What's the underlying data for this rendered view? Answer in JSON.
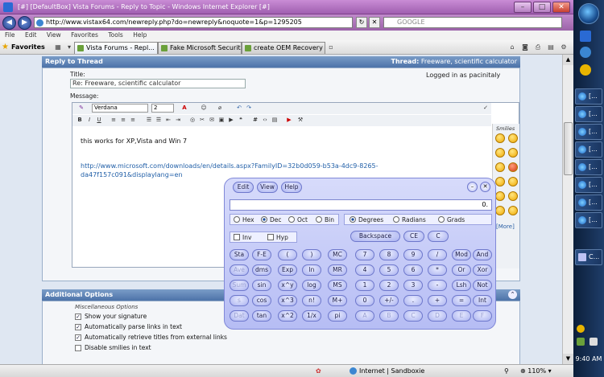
{
  "window": {
    "title": "[#] [DefaultBox] Vista Forums - Reply to Topic - Windows Internet Explorer [#]",
    "min": "–",
    "max": "□",
    "close": "✕"
  },
  "address": {
    "url": "http://www.vistax64.com/newreply.php?do=newreply&noquote=1&p=1295205",
    "search_placeholder": "GOOGLE"
  },
  "menu": [
    "File",
    "Edit",
    "View",
    "Favorites",
    "Tools",
    "Help"
  ],
  "favorites": {
    "label": "Favorites"
  },
  "tabs": [
    {
      "label": "Vista Forums - Repl..."
    },
    {
      "label": "Fake Microsoft Securit..."
    },
    {
      "label": "create OEM Recovery ..."
    }
  ],
  "reply": {
    "header": "Reply to Thread",
    "thread_label": "Thread:",
    "thread_title": "Freeware, scientific calculator",
    "logged_in_prefix": "Logged in as",
    "user": "pacinitaly",
    "title_label": "Title:",
    "title_value": "Re: Freeware, scientific calculator",
    "message_label": "Message:",
    "font": "Verdana",
    "size": "2",
    "message_line": "this works for XP,Vista and Win 7",
    "message_link": "http://www.microsoft.com/downloads/en/details.aspx?FamilyID=32b0d059-b53a-4dc9-8265-da47f157c091&displaylang=en",
    "smilies_title": "Smilies",
    "more": "[More]"
  },
  "options": {
    "header": "Additional Options",
    "misc_title": "Miscellaneous Options",
    "items": [
      {
        "label": "Show your signature",
        "checked": "✓"
      },
      {
        "label": "Automatically parse links in text",
        "checked": "✓"
      },
      {
        "label": "Automatically retrieve titles from external links",
        "checked": "✓"
      },
      {
        "label": "Disable smilies in text",
        "checked": ""
      }
    ]
  },
  "calculator": {
    "menu": [
      "Edit",
      "View",
      "Help"
    ],
    "display": "0.",
    "base": [
      "Hex",
      "Dec",
      "Oct",
      "Bin"
    ],
    "angle": [
      "Degrees",
      "Radians",
      "Grads"
    ],
    "inv": "Inv",
    "hyp": "Hyp",
    "backspace": "Backspace",
    "ce": "CE",
    "c": "C",
    "rows": [
      [
        "Sta",
        "F-E",
        "(",
        ")",
        "MC",
        "7",
        "8",
        "9",
        "/",
        "Mod",
        "And"
      ],
      [
        "Ave",
        "dms",
        "Exp",
        "ln",
        "MR",
        "4",
        "5",
        "6",
        "*",
        "Or",
        "Xor"
      ],
      [
        "Sum",
        "sin",
        "x^y",
        "log",
        "MS",
        "1",
        "2",
        "3",
        "-",
        "Lsh",
        "Not"
      ],
      [
        "s",
        "cos",
        "x^3",
        "n!",
        "M+",
        "0",
        "+/-",
        ".",
        "+",
        "=",
        "Int"
      ],
      [
        "Dat",
        "tan",
        "x^2",
        "1/x",
        "pi",
        "A",
        "B",
        "C",
        "D",
        "E",
        "F"
      ]
    ]
  },
  "status": {
    "zone": "Internet | Sandboxie",
    "zoom": "110%"
  },
  "taskbar": {
    "items": [
      "[...",
      "[...",
      "[...",
      "[...",
      "[...",
      "[...",
      "[...",
      "[...",
      "C..."
    ],
    "time": "9:40 AM"
  }
}
